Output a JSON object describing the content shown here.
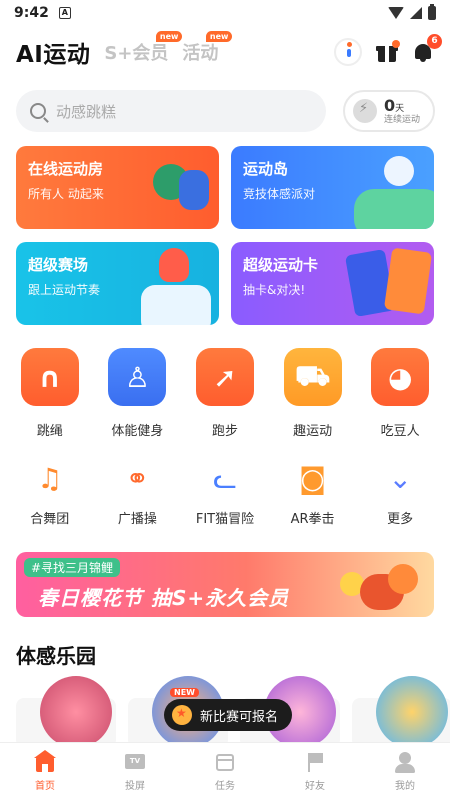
{
  "status_bar": {
    "time": "9:42",
    "note_glyph": "A"
  },
  "header": {
    "title": "AI运动",
    "tabs": [
      {
        "label": "S+会员",
        "badge": "new"
      },
      {
        "label": "活动",
        "badge": "new"
      }
    ],
    "notification_count": "6"
  },
  "search": {
    "placeholder": "动感跳糕"
  },
  "streak": {
    "value": "0",
    "unit": "天",
    "label": "连续运动"
  },
  "cards": [
    {
      "title": "在线运动房",
      "subtitle": "所有人 动起来"
    },
    {
      "title": "运动岛",
      "subtitle": "竞技体感派对"
    },
    {
      "title": "超级赛场",
      "subtitle": "跟上运动节奏"
    },
    {
      "title": "超级运动卡",
      "subtitle": "抽卡&对决!"
    }
  ],
  "grid_row1": [
    {
      "label": "跳绳",
      "icon": "jump-rope-icon"
    },
    {
      "label": "体能健身",
      "icon": "fitness-icon"
    },
    {
      "label": "跑步",
      "icon": "running-icon"
    },
    {
      "label": "趣运动",
      "icon": "fun-sport-icon"
    },
    {
      "label": "吃豆人",
      "icon": "pacman-icon"
    }
  ],
  "grid_row2": [
    {
      "label": "合舞团",
      "icon": "dance-icon"
    },
    {
      "label": "广播操",
      "icon": "exercise-icon"
    },
    {
      "label": "FIT猫冒险",
      "icon": "fit-cat-icon"
    },
    {
      "label": "AR拳击",
      "icon": "boxing-glove-icon"
    },
    {
      "label": "更多",
      "icon": "more-icon"
    }
  ],
  "banner": {
    "tag": "#寻找三月锦鲤",
    "text": "春日樱花节  抽S+永久会员"
  },
  "section": {
    "title": "体感乐园"
  },
  "toast": {
    "badge": "NEW",
    "text": "新比赛可报名"
  },
  "bottom_nav": [
    {
      "label": "首页",
      "icon": "home-icon",
      "active": true
    },
    {
      "label": "投屏",
      "icon": "tv-icon",
      "active": false
    },
    {
      "label": "任务",
      "icon": "calendar-icon",
      "active": false
    },
    {
      "label": "好友",
      "icon": "flag-icon",
      "active": false
    },
    {
      "label": "我的",
      "icon": "user-icon",
      "active": false
    }
  ],
  "colors": {
    "accent": "#ff5d2e",
    "blue": "#3a6ff0",
    "amber": "#ffa52e"
  }
}
